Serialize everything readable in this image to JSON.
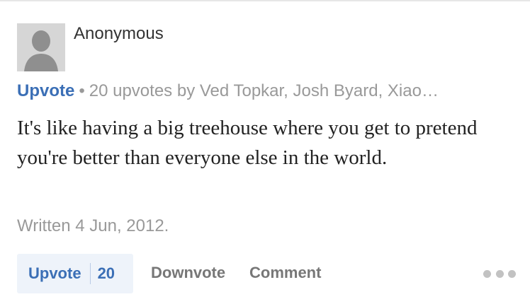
{
  "answer": {
    "author": "Anonymous",
    "meta": {
      "upvote_label": "Upvote",
      "separator": "•",
      "upvote_summary": "20 upvotes by Ved Topkar, Josh Byard, Xiao…"
    },
    "body": "It's like having a big treehouse where you get to pretend you're better than everyone else in the world.",
    "written": "Written 4 Jun, 2012."
  },
  "actions": {
    "upvote_label": "Upvote",
    "upvote_count": "20",
    "downvote_label": "Downvote",
    "comment_label": "Comment",
    "more_icon": "more-horizontal-icon"
  },
  "colors": {
    "accent": "#3b6fb6",
    "upvote_bg": "#eef3fa",
    "muted": "#999999",
    "action_text": "#777777"
  }
}
